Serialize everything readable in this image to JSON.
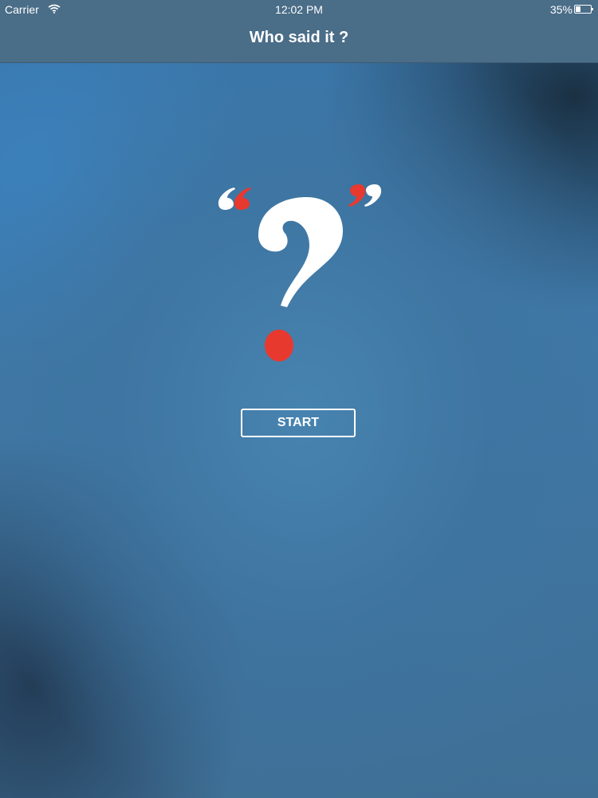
{
  "status_bar": {
    "carrier": "Carrier",
    "time": "12:02 PM",
    "battery": "35%"
  },
  "nav": {
    "title": "Who said it ?"
  },
  "logo": {
    "question_color": "#ffffff",
    "accent_color": "#e8392f"
  },
  "start_label": "START",
  "icons": [
    "wifi-icon",
    "battery-icon"
  ]
}
